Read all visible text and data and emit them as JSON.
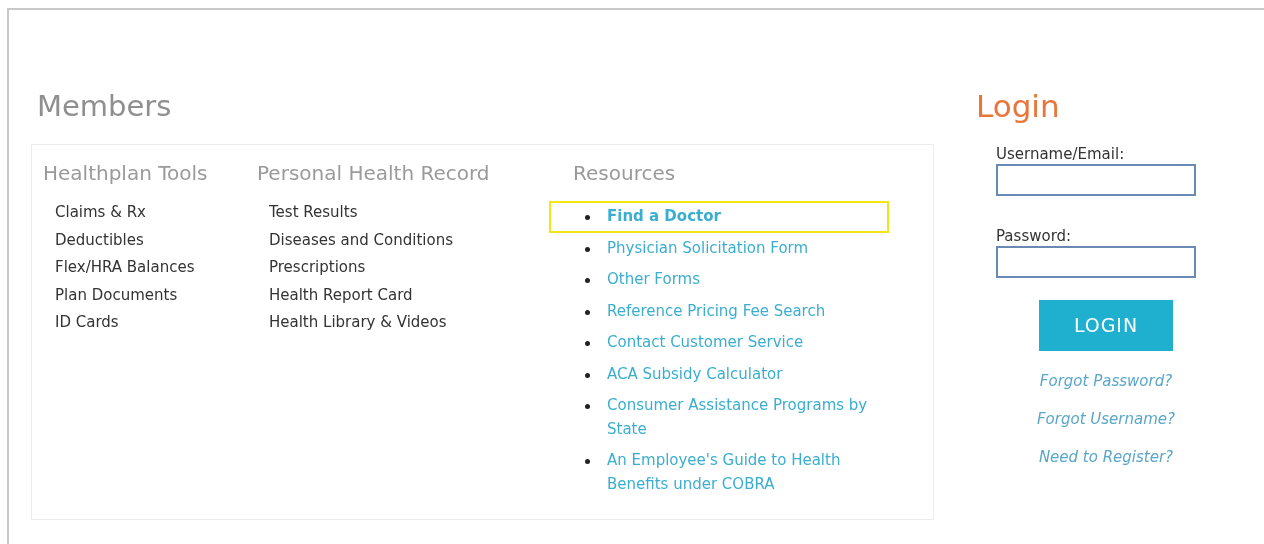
{
  "members": {
    "title": "Members",
    "columns": [
      {
        "heading": "Healthplan Tools",
        "kind": "plain",
        "items": [
          {
            "label": "Claims & Rx"
          },
          {
            "label": "Deductibles"
          },
          {
            "label": "Flex/HRA Balances"
          },
          {
            "label": "Plan Documents"
          },
          {
            "label": "ID Cards"
          }
        ]
      },
      {
        "heading": "Personal Health Record",
        "kind": "plain",
        "items": [
          {
            "label": "Test Results"
          },
          {
            "label": "Diseases and Conditions"
          },
          {
            "label": "Prescriptions"
          },
          {
            "label": "Health Report Card"
          },
          {
            "label": "Health Library & Videos"
          }
        ]
      },
      {
        "heading": "Resources",
        "kind": "links",
        "items": [
          {
            "label": "Find a Doctor",
            "highlighted": true
          },
          {
            "label": "Physician Solicitation Form",
            "highlighted": false
          },
          {
            "label": "Other Forms",
            "highlighted": false
          },
          {
            "label": "Reference Pricing Fee Search",
            "highlighted": false
          },
          {
            "label": "Contact Customer Service",
            "highlighted": false
          },
          {
            "label": "ACA Subsidy Calculator",
            "highlighted": false
          },
          {
            "label": "Consumer Assistance Programs by State",
            "highlighted": false
          },
          {
            "label": "An Employee's Guide to Health Benefits under COBRA",
            "highlighted": false
          }
        ]
      }
    ]
  },
  "login": {
    "title": "Login",
    "fields": [
      {
        "label": "Username/Email:"
      },
      {
        "label": "Password:"
      }
    ],
    "button": "LOGIN",
    "links": [
      "Forgot Password?",
      "Forgot Username?",
      "Need to Register?"
    ]
  }
}
